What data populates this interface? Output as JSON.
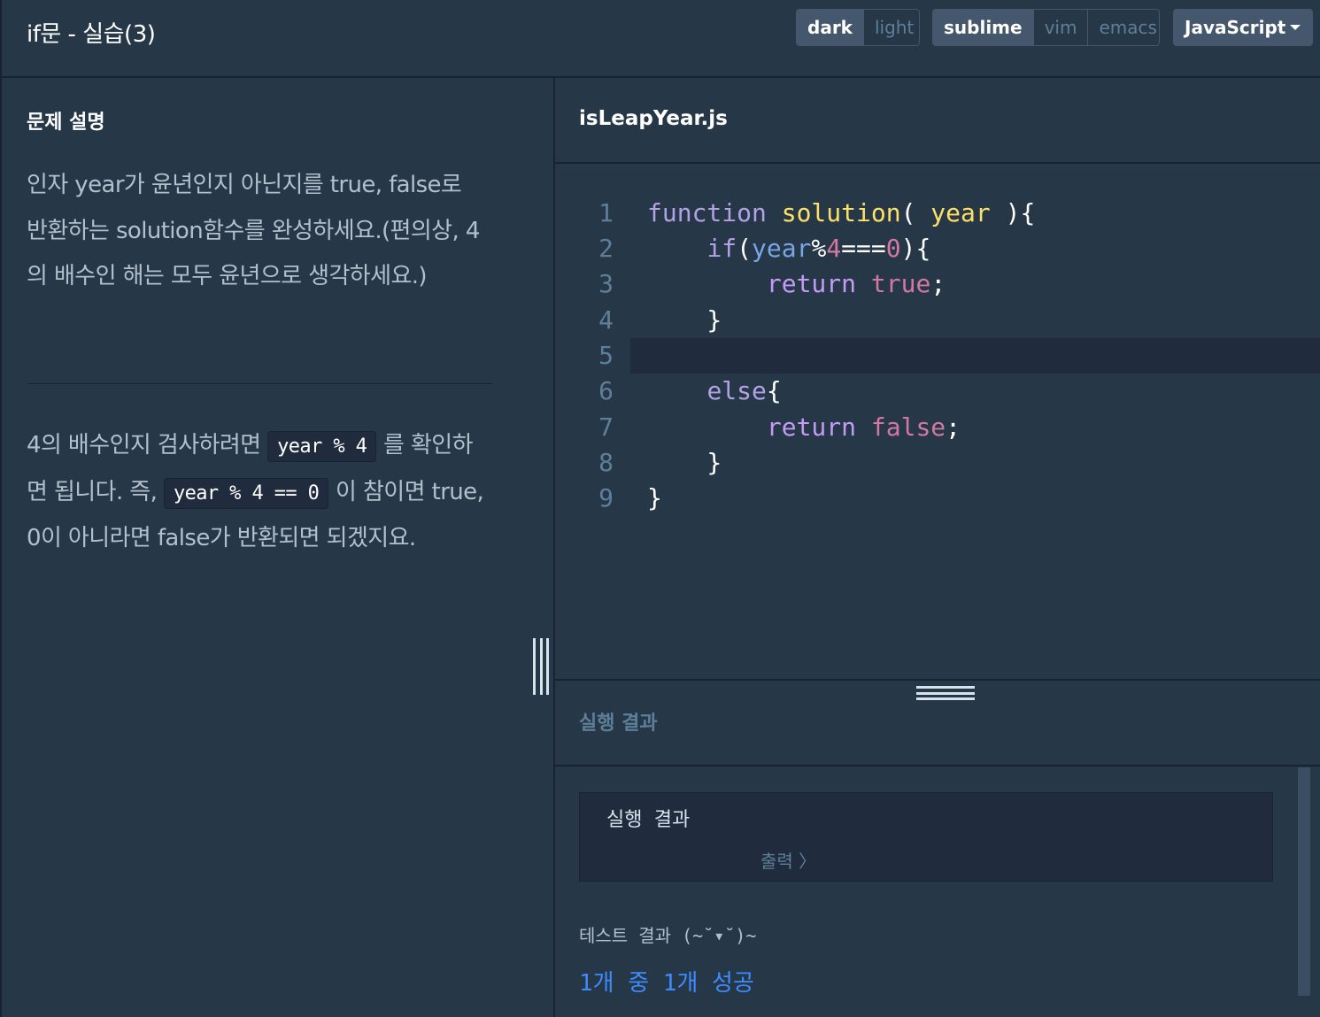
{
  "header": {
    "title": "if문 - 실습(3)",
    "theme_options": [
      "dark",
      "light"
    ],
    "theme_selected": "dark",
    "keymap_options": [
      "sublime",
      "vim",
      "emacs"
    ],
    "keymap_selected": "sublime",
    "language": "JavaScript"
  },
  "problem": {
    "heading": "문제 설명",
    "paragraph1": "인자 year가 윤년인지 아닌지를 true, false로 반환하는 solution함수를 완성하세요.(편의상, 4의 배수인 해는 모두 윤년으로 생각하세요.)",
    "p2_part1": "4의 배수인지 검사하려면 ",
    "p2_code1": "year % 4",
    "p2_part2": " 를 확인하면 됩니다. 즉, ",
    "p2_code2": "year % 4 == 0",
    "p2_part3": " 이 참이면 true, 0이 아니라면 false가 반환되면 되겠지요."
  },
  "editor": {
    "filename": "isLeapYear.js",
    "line_numbers": [
      "1",
      "2",
      "3",
      "4",
      "5",
      "6",
      "7",
      "8",
      "9"
    ]
  },
  "result": {
    "title": "실행 결과",
    "output_title": "실행 결과",
    "output_placeholder": "출력 〉",
    "test_label": "테스트 결과 (~˘▾˘)~",
    "test_summary": "1개 중 1개 성공"
  },
  "colors": {
    "background": "#263747",
    "border": "#172334",
    "accent": "#3d8bfd"
  }
}
